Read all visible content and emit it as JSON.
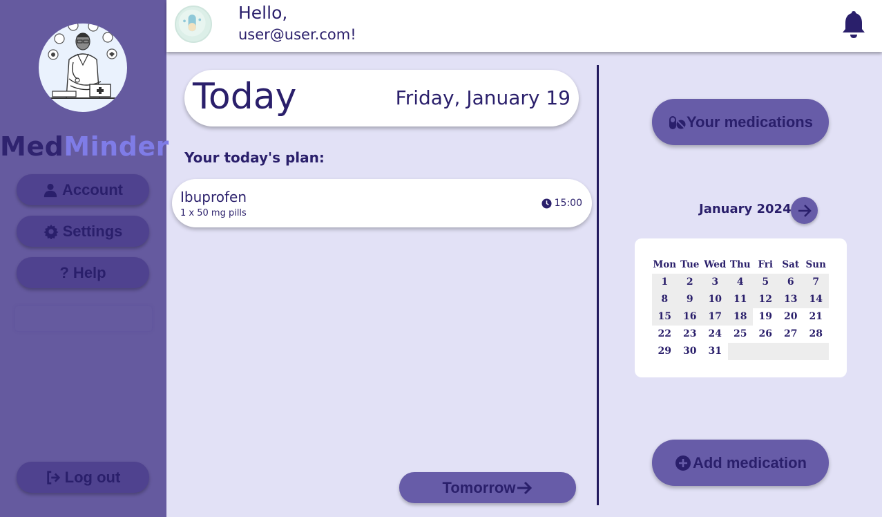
{
  "brand": {
    "part1": "Med",
    "part2": "Minder"
  },
  "sidebar": {
    "account_label": "Account",
    "settings_label": "Settings",
    "help_label": "? Help",
    "logout_label": "Log out"
  },
  "header": {
    "greeting": "Hello,",
    "user_email": "user@user.com!"
  },
  "today": {
    "title": "Today",
    "date": "Friday, January 19",
    "plan_label": "Your today's plan:",
    "medications": [
      {
        "name": "Ibuprofen",
        "dose": "1 x 50 mg pills",
        "time": "15:00"
      }
    ],
    "tomorrow_label": "Tomorrow"
  },
  "right_panel": {
    "your_medications_label": "Your medications",
    "add_medication_label": "Add medication"
  },
  "calendar": {
    "month_label": "January 2024",
    "weekdays": [
      "Mon",
      "Tue",
      "Wed",
      "Thu",
      "Fri",
      "Sat",
      "Sun"
    ],
    "days": [
      "1",
      "2",
      "3",
      "4",
      "5",
      "6",
      "7",
      "8",
      "9",
      "10",
      "11",
      "12",
      "13",
      "14",
      "15",
      "16",
      "17",
      "18",
      "19",
      "20",
      "21",
      "22",
      "23",
      "24",
      "25",
      "26",
      "27",
      "28",
      "29",
      "30",
      "31"
    ],
    "current_day": 19
  },
  "colors": {
    "sidebar_bg": "#655a9f",
    "page_bg": "#e2e1f6",
    "button_bg": "#675ca8",
    "text_dark": "#2a1f6b",
    "brand_accent": "#7f7ce7"
  },
  "icons": {
    "account": "user-icon",
    "settings": "gear-icon",
    "logout": "logout-icon",
    "notifications": "bell-icon",
    "time": "clock-icon",
    "medications": "pills-icon",
    "add": "plus-circle-icon",
    "next": "arrow-right-icon"
  }
}
